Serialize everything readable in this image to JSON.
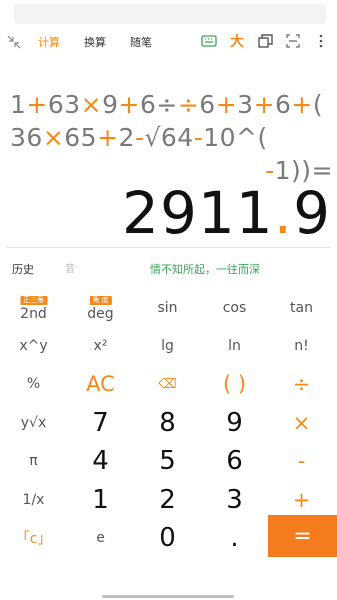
{
  "topbar": {
    "collapse_icon": "collapse-arrows-icon",
    "tabs": [
      {
        "label": "计算",
        "active": true
      },
      {
        "label": "换算",
        "active": false
      },
      {
        "label": "随笔",
        "active": false
      }
    ],
    "icons": [
      "keyboard-icon",
      "font-size-icon",
      "copy-window-icon",
      "scan-icon",
      "more-vertical-icon"
    ],
    "font_size_label": "大"
  },
  "display": {
    "expression_lines": [
      [
        [
          "n",
          "1"
        ],
        [
          "o",
          "+"
        ],
        [
          "n",
          "63"
        ],
        [
          "o",
          "×"
        ],
        [
          "n",
          "9"
        ],
        [
          "o",
          "+"
        ],
        [
          "n",
          "6"
        ],
        [
          "n",
          "÷"
        ],
        [
          "o",
          "÷"
        ],
        [
          "n",
          "6"
        ],
        [
          "o",
          "+"
        ],
        [
          "n",
          "3"
        ],
        [
          "o",
          "+"
        ],
        [
          "n",
          "6"
        ],
        [
          "o",
          "+"
        ],
        [
          "n",
          "("
        ]
      ],
      [
        [
          "n",
          "36"
        ],
        [
          "o",
          "×"
        ],
        [
          "n",
          "65"
        ],
        [
          "o",
          "+"
        ],
        [
          "n",
          "2"
        ],
        [
          "o",
          "-"
        ],
        [
          "n",
          "√64"
        ],
        [
          "o",
          "-"
        ],
        [
          "n",
          "10^("
        ]
      ],
      [
        [
          "o",
          "-"
        ],
        [
          "n",
          "1))="
        ]
      ]
    ],
    "result_int": "2911",
    "result_dot": ".",
    "result_frac": "9"
  },
  "history_row": {
    "history_label": "历史",
    "sound_label": "音",
    "slogan": "情不知所起，一往而深"
  },
  "keys": [
    [
      {
        "label": "2nd",
        "badge": "正三角",
        "style": "fn"
      },
      {
        "label": "deg",
        "badge": "角 度",
        "style": "fn"
      },
      {
        "label": "sin",
        "style": "fn"
      },
      {
        "label": "cos",
        "style": "fn"
      },
      {
        "label": "tan",
        "style": "fn"
      }
    ],
    [
      {
        "label": "x^y",
        "style": "fn"
      },
      {
        "label": "x²",
        "style": "fn"
      },
      {
        "label": "lg",
        "style": "fn"
      },
      {
        "label": "ln",
        "style": "fn"
      },
      {
        "label": "n!",
        "style": "fn"
      }
    ],
    [
      {
        "label": "%",
        "style": "fn"
      },
      {
        "label": "AC",
        "style": "big-orange"
      },
      {
        "label": "⌫",
        "style": "orange-small"
      },
      {
        "label": "( )",
        "style": "big-orange"
      },
      {
        "label": "÷",
        "style": "big-orange"
      }
    ],
    [
      {
        "label": "y√x",
        "style": "fn"
      },
      {
        "label": "7",
        "style": "num"
      },
      {
        "label": "8",
        "style": "num"
      },
      {
        "label": "9",
        "style": "num"
      },
      {
        "label": "×",
        "style": "big-orange"
      }
    ],
    [
      {
        "label": "π",
        "style": "fn"
      },
      {
        "label": "4",
        "style": "num"
      },
      {
        "label": "5",
        "style": "num"
      },
      {
        "label": "6",
        "style": "num"
      },
      {
        "label": "-",
        "style": "big-orange"
      }
    ],
    [
      {
        "label": "1/x",
        "style": "fn"
      },
      {
        "label": "1",
        "style": "num"
      },
      {
        "label": "2",
        "style": "num"
      },
      {
        "label": "3",
        "style": "num"
      },
      {
        "label": "+",
        "style": "big-orange"
      }
    ],
    [
      {
        "label": "「c」",
        "style": "orange-fn"
      },
      {
        "label": "e",
        "style": "fn"
      },
      {
        "label": "0",
        "style": "num"
      },
      {
        "label": ".",
        "style": "num"
      },
      {
        "label": "=",
        "style": "equals"
      }
    ]
  ],
  "colors": {
    "accent": "#f28a1a",
    "slogan": "#3aa35a",
    "equals_bg": "#f47c1e"
  }
}
